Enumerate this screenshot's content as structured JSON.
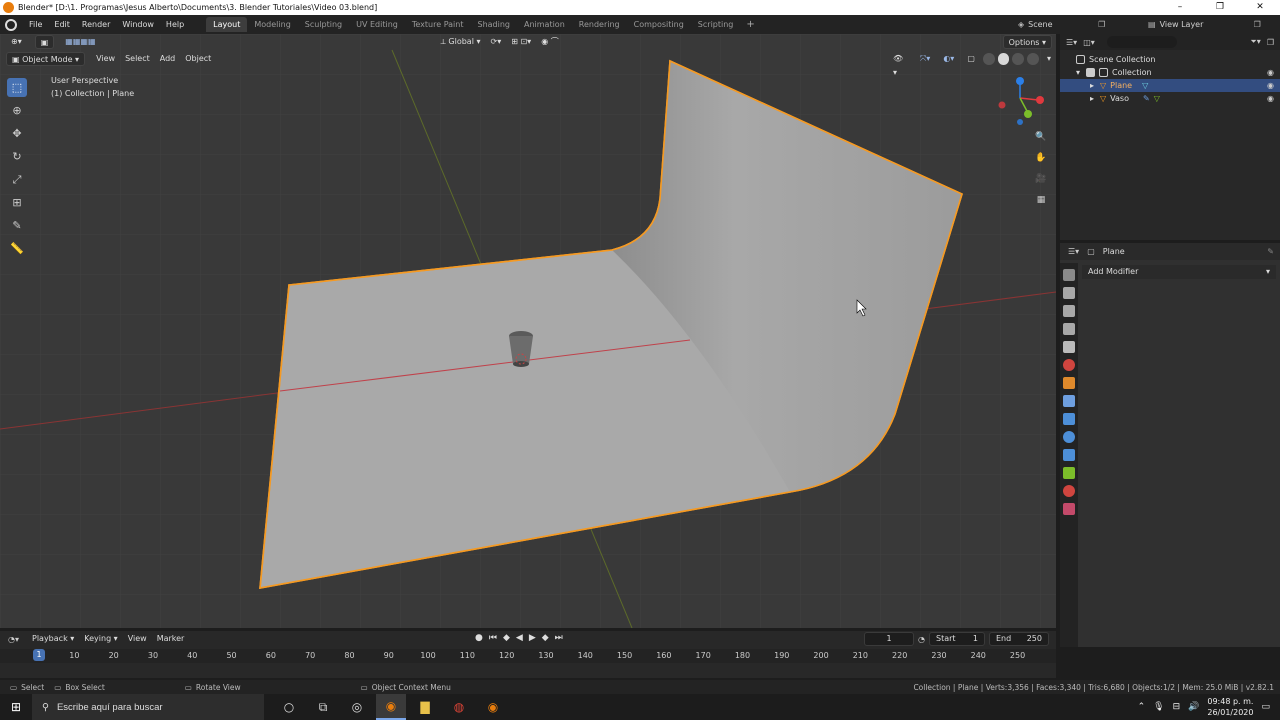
{
  "window": {
    "title": "Blender* [D:\\1. Programas\\Jesus Alberto\\Documents\\3. Blender Tutoriales\\Video 03.blend]",
    "controls": [
      "–",
      "❐",
      "✕"
    ]
  },
  "menu": [
    "File",
    "Edit",
    "Render",
    "Window",
    "Help"
  ],
  "workspaces": {
    "tabs": [
      "Layout",
      "Modeling",
      "Sculpting",
      "UV Editing",
      "Texture Paint",
      "Shading",
      "Animation",
      "Rendering",
      "Compositing",
      "Scripting"
    ],
    "active": "Layout",
    "add": "+"
  },
  "scene": {
    "name": "Scene"
  },
  "view_layer": {
    "name": "View Layer"
  },
  "viewport": {
    "transform_orientation": "Global",
    "options_label": "Options",
    "mode": "Object Mode",
    "header_menu": [
      "View",
      "Select",
      "Add",
      "Object"
    ],
    "info_line1": "User Perspective",
    "info_line2": "(1) Collection | Plane",
    "tools": [
      "select-box-tool",
      "cursor-tool",
      "move-tool",
      "rotate-tool",
      "scale-tool",
      "transform-tool",
      "annotate-tool",
      "measure-tool"
    ],
    "gizmo_axes": {
      "x": "#e0393e",
      "y": "#7cbe2a",
      "z": "#2b7fe8"
    },
    "accent_selection": "#f59a23"
  },
  "outliner": {
    "root": "Scene Collection",
    "collection": "Collection",
    "items": [
      {
        "name": "Plane",
        "selected": true
      },
      {
        "name": "Vaso",
        "selected": false
      }
    ]
  },
  "properties": {
    "object_name": "Plane",
    "add_modifier": "Add Modifier"
  },
  "timeline": {
    "menu": [
      "Playback",
      "Keying",
      "View",
      "Marker"
    ],
    "current_frame": "1",
    "start_label": "Start",
    "start": "1",
    "end_label": "End",
    "end": "250",
    "ruler": [
      "1",
      "10",
      "20",
      "30",
      "40",
      "50",
      "60",
      "70",
      "80",
      "90",
      "100",
      "110",
      "120",
      "130",
      "140",
      "150",
      "160",
      "170",
      "180",
      "190",
      "200",
      "210",
      "220",
      "230",
      "240",
      "250"
    ],
    "ruler_frames": [
      1,
      10,
      20,
      30,
      40,
      50,
      60,
      70,
      80,
      90,
      100,
      110,
      120,
      130,
      140,
      150,
      160,
      170,
      180,
      190,
      200,
      210,
      220,
      230,
      240,
      250
    ]
  },
  "status": {
    "select": "Select",
    "box_select": "Box Select",
    "rotate_view": "Rotate View",
    "context_menu": "Object Context Menu",
    "stats": "Collection | Plane | Verts:3,356 | Faces:3,340 | Tris:6,680 | Objects:1/2 | Mem: 25.0 MiB | v2.82.1"
  },
  "taskbar": {
    "search_placeholder": "Escribe aquí para buscar",
    "time": "09:48 p. m.",
    "date": "26/01/2020"
  }
}
